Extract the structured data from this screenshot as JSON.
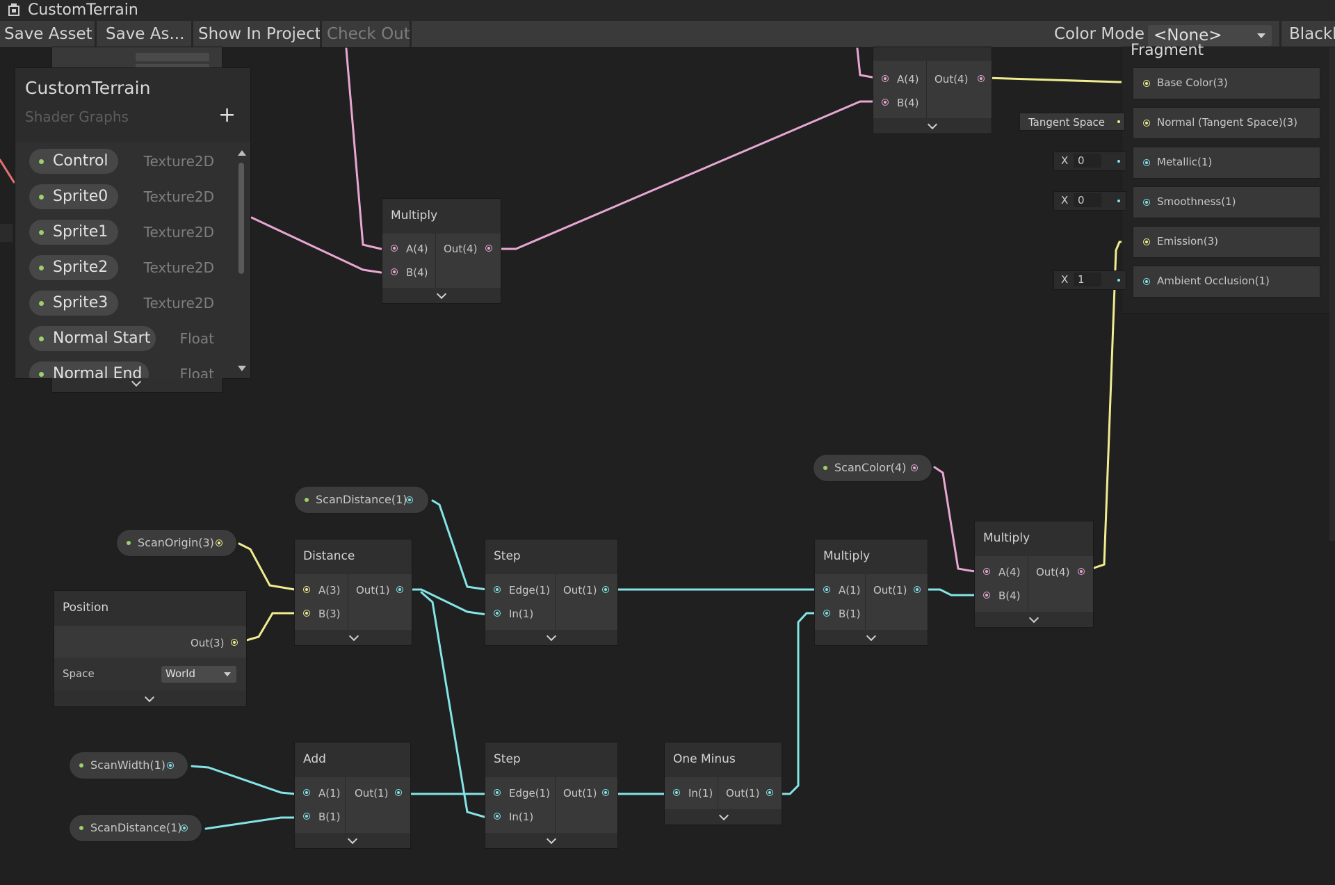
{
  "window": {
    "title": "CustomTerrain"
  },
  "toolbar": {
    "save_asset": "Save Asset",
    "save_as": "Save As...",
    "show_in_project": "Show In Project",
    "check_out": "Check Out",
    "color_mode_label": "Color Mode",
    "color_mode_value": "<None>",
    "blackboard": "Blackb"
  },
  "blackboard": {
    "title": "CustomTerrain",
    "subtitle": "Shader Graphs",
    "add_icon": "+",
    "properties": [
      {
        "name": "Control",
        "type": "Texture2D"
      },
      {
        "name": "Sprite0",
        "type": "Texture2D"
      },
      {
        "name": "Sprite1",
        "type": "Texture2D"
      },
      {
        "name": "Sprite2",
        "type": "Texture2D"
      },
      {
        "name": "Sprite3",
        "type": "Texture2D"
      },
      {
        "name": "Normal Start",
        "type": "Float"
      },
      {
        "name": "Normal End",
        "type": "Float"
      }
    ]
  },
  "colors": {
    "vector4": "#e8a7d3",
    "vector3": "#f0ec8f",
    "vector1": "#84e4e7",
    "property_dot": "#9bd16a"
  },
  "nodes": {
    "multiply_top": {
      "title": "Multiply",
      "in_a": "A(4)",
      "in_b": "B(4)",
      "out": "Out(4)"
    },
    "add_top": {
      "in_a": "A(4)",
      "in_b": "B(4)",
      "out": "Out(4)"
    },
    "distance": {
      "title": "Distance",
      "in_a": "A(3)",
      "in_b": "B(3)",
      "out": "Out(1)"
    },
    "step1": {
      "title": "Step",
      "in_a": "Edge(1)",
      "in_b": "In(1)",
      "out": "Out(1)"
    },
    "step2": {
      "title": "Step",
      "in_a": "Edge(1)",
      "in_b": "In(1)",
      "out": "Out(1)"
    },
    "add_bottom": {
      "title": "Add",
      "in_a": "A(1)",
      "in_b": "B(1)",
      "out": "Out(1)"
    },
    "one_minus": {
      "title": "One Minus",
      "in_a": "In(1)",
      "out": "Out(1)"
    },
    "multiply_mid": {
      "title": "Multiply",
      "in_a": "A(1)",
      "in_b": "B(1)",
      "out": "Out(1)"
    },
    "multiply_right": {
      "title": "Multiply",
      "in_a": "A(4)",
      "in_b": "B(4)",
      "out": "Out(4)"
    },
    "position": {
      "title": "Position",
      "out": "Out(3)",
      "space_label": "Space",
      "space_value": "World"
    }
  },
  "property_nodes": {
    "scan_distance_top": "ScanDistance(1)",
    "scan_origin": "ScanOrigin(3)",
    "scan_color": "ScanColor(4)",
    "scan_width": "ScanWidth(1)",
    "scan_distance_bottom": "ScanDistance(1)"
  },
  "master": {
    "title": "Fragment",
    "slots": [
      {
        "label": "Base Color(3)"
      },
      {
        "label": "Normal (Tangent Space)(3)",
        "field": "Tangent Space"
      },
      {
        "label": "Metallic(1)",
        "field_x": "X",
        "field_value": "0"
      },
      {
        "label": "Smoothness(1)",
        "field_x": "X",
        "field_value": "0"
      },
      {
        "label": "Emission(3)"
      },
      {
        "label": "Ambient Occlusion(1)",
        "field_x": "X",
        "field_value": "1"
      }
    ]
  }
}
